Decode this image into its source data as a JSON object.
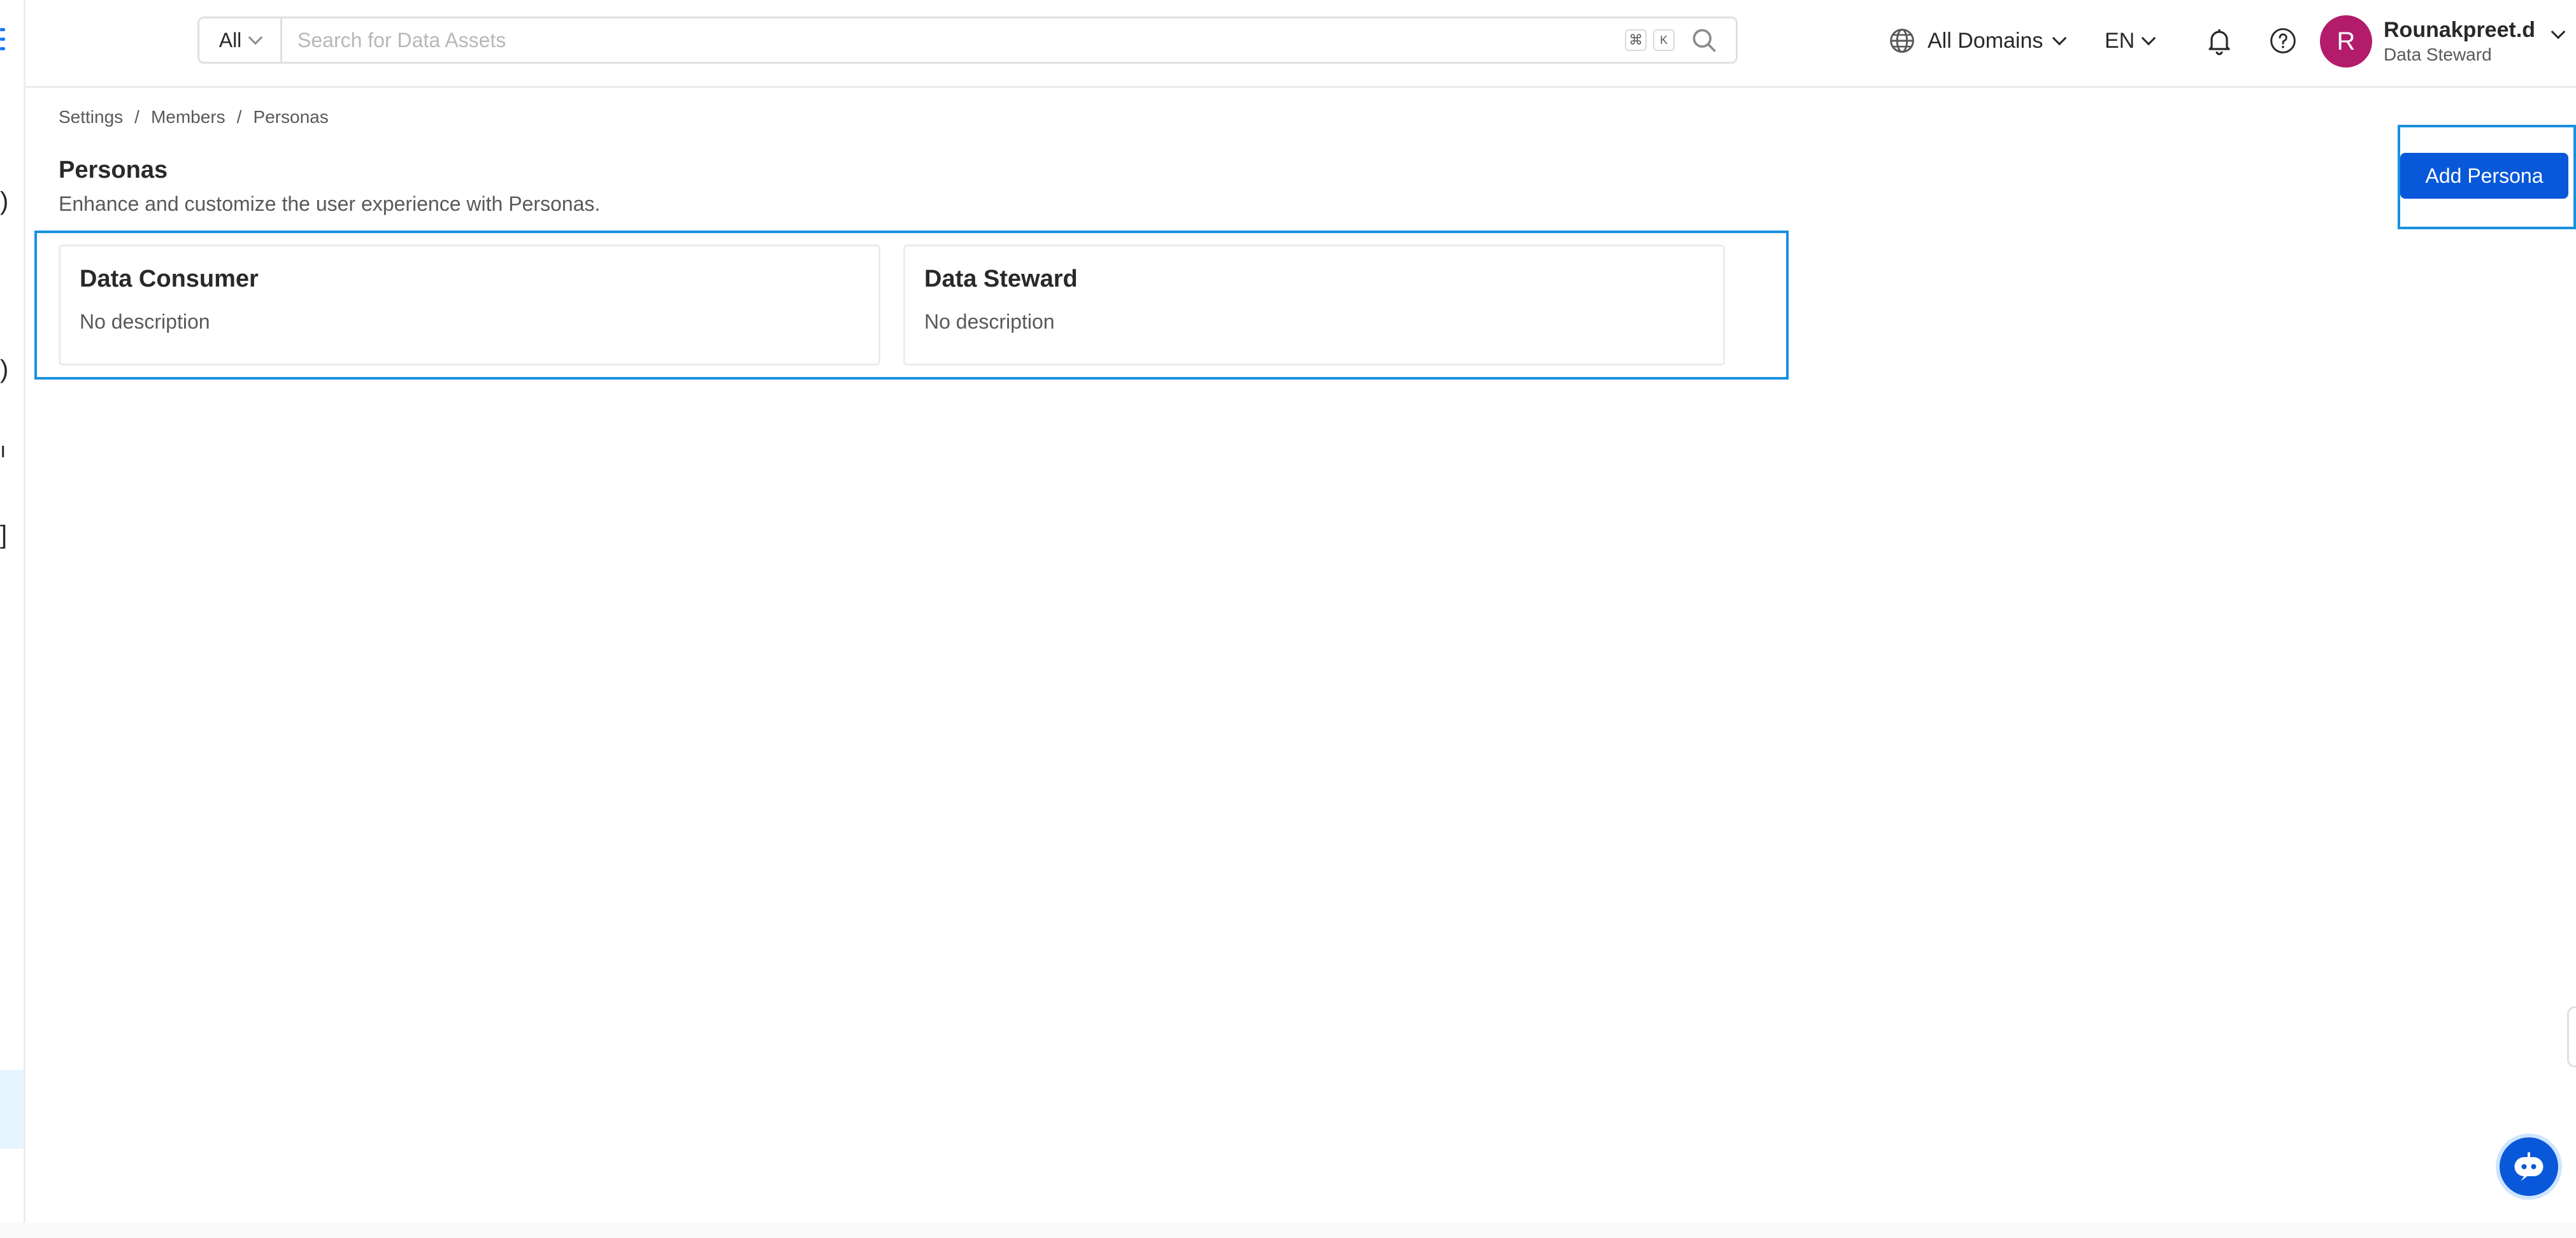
{
  "header": {
    "search": {
      "type_label": "All",
      "placeholder": "Search for Data Assets",
      "shortcut_keys": [
        "⌘",
        "K"
      ]
    },
    "domains_label": "All Domains",
    "language_label": "EN",
    "user": {
      "initial": "R",
      "name": "Rounakpreet.d",
      "role": "Data Steward"
    }
  },
  "breadcrumb": [
    {
      "label": "Settings"
    },
    {
      "label": "Members"
    },
    {
      "label": "Personas"
    }
  ],
  "breadcrumb_separator": "/",
  "page": {
    "title": "Personas",
    "subtitle": "Enhance and customize the user experience with Personas.",
    "add_button_label": "Add Persona"
  },
  "personas": [
    {
      "name": "Data Consumer",
      "description": "No description"
    },
    {
      "name": "Data Steward",
      "description": "No description"
    }
  ],
  "colors": {
    "accent": "#0958d9",
    "highlight_border": "#1890e0",
    "avatar": "#b21c6b"
  },
  "icons": [
    "menu-icon",
    "search-icon",
    "globe-icon",
    "bell-icon",
    "help-icon",
    "chatbot-icon"
  ]
}
